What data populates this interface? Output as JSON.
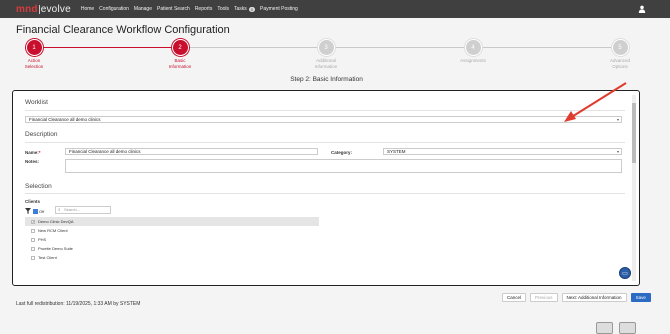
{
  "brand": {
    "part1": "mnd",
    "part2": "evolve"
  },
  "nav": {
    "items": [
      "Home",
      "Configuration",
      "Manage",
      "Patient Search",
      "Reports",
      "Tools",
      "Tasks",
      "Payment Posting"
    ],
    "tasks_badge": "0"
  },
  "page": {
    "title": "Financial Clearance Workflow Configuration",
    "step_heading": "Step 2: Basic Information"
  },
  "steps": [
    {
      "number": "1",
      "line1": "Action",
      "line2": "Selection",
      "state": "active"
    },
    {
      "number": "2",
      "line1": "Basic",
      "line2": "Information",
      "state": "active"
    },
    {
      "number": "3",
      "line1": "Additional",
      "line2": "Information",
      "state": "inactive"
    },
    {
      "number": "4",
      "line1": "",
      "line2": "Assignments",
      "state": "inactive"
    },
    {
      "number": "5",
      "line1": "Advanced",
      "line2": "Options",
      "state": "inactive"
    }
  ],
  "worklist": {
    "section_title": "Worklist",
    "value": "Financial Clearance all demo clinics"
  },
  "description": {
    "section_title": "Description",
    "name_label": "Name:",
    "name_required": "*",
    "name_value": "Financial Clearance all demo clinics",
    "notes_label": "Notes:",
    "category_label": "Category:",
    "category_value": "SYSTEM"
  },
  "selection": {
    "section_title": "Selection",
    "clients_label": "Clients",
    "toggle_label": "Off",
    "search_placeholder": "Search...",
    "clients": [
      {
        "name": "Demo Clinic DevQA",
        "checked": true
      },
      {
        "name": "New RCM Client",
        "checked": false
      },
      {
        "name": "PHS",
        "checked": false
      },
      {
        "name": "Pruette Demo Suite",
        "checked": false
      },
      {
        "name": "Test Client",
        "checked": false
      }
    ]
  },
  "footer": {
    "last_redistribution": "Last full redistribution: 11/19/2025, 1:33 AM by SYSTEM",
    "cancel": "Cancel",
    "previous": "Previous",
    "next": "Next: Additional Information",
    "save": "Save"
  },
  "colors": {
    "accent": "#c8102e",
    "nav_bg": "#404040",
    "primary_button": "#2b6bc4",
    "annotation_arrow": "#e03b2e"
  },
  "icons": [
    "user-icon",
    "filter-icon",
    "search-icon",
    "dropdown-caret-icon",
    "floating-action-icon"
  ]
}
